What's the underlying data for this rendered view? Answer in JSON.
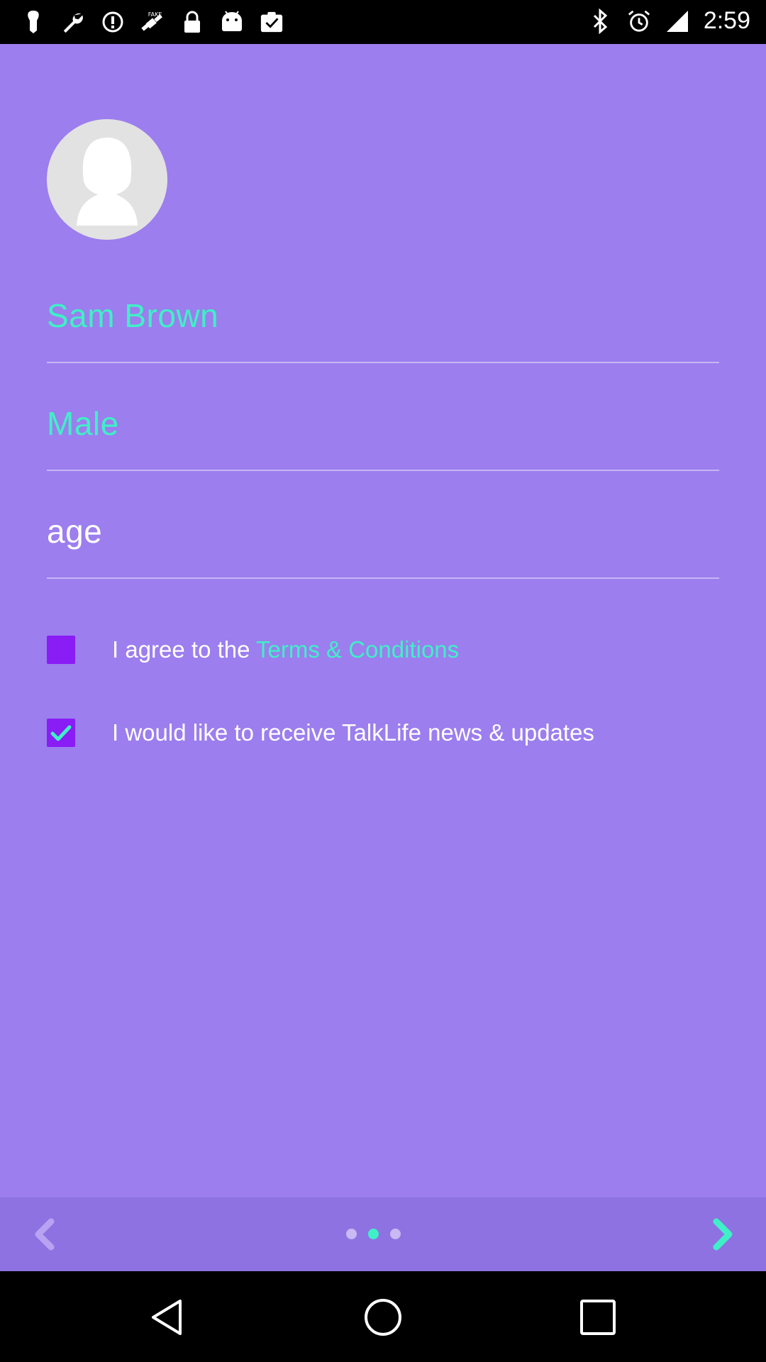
{
  "status_bar": {
    "left_icons": [
      "notification-pin-icon",
      "wrench-icon",
      "info-icon",
      "fake-gps-icon",
      "lock-icon",
      "android-icon",
      "clipboard-check-icon"
    ],
    "right_icons": [
      "bluetooth-icon",
      "alarm-icon",
      "signal-icon"
    ],
    "time": "2:59"
  },
  "profile": {
    "avatar_icon": "default-avatar-icon",
    "name": "Sam Brown",
    "gender": "Male",
    "age_placeholder": "age"
  },
  "checkboxes": {
    "terms": {
      "checked": false,
      "label_prefix": "I agree to the ",
      "label_link": "Terms & Conditions"
    },
    "newsletter": {
      "checked": true,
      "label": "I would like to receive TalkLife news & updates"
    }
  },
  "pager": {
    "back_icon": "chevron-left-icon",
    "next_icon": "chevron-right-icon",
    "page_count": 3,
    "current_page": 2
  },
  "colors": {
    "background": "#9c7eee",
    "accent": "#3ff0c7",
    "checkbox": "#8a1cf5",
    "bottom_bar": "#8e72e2"
  },
  "system_nav": [
    "back-triangle-icon",
    "home-circle-icon",
    "recents-square-icon"
  ]
}
